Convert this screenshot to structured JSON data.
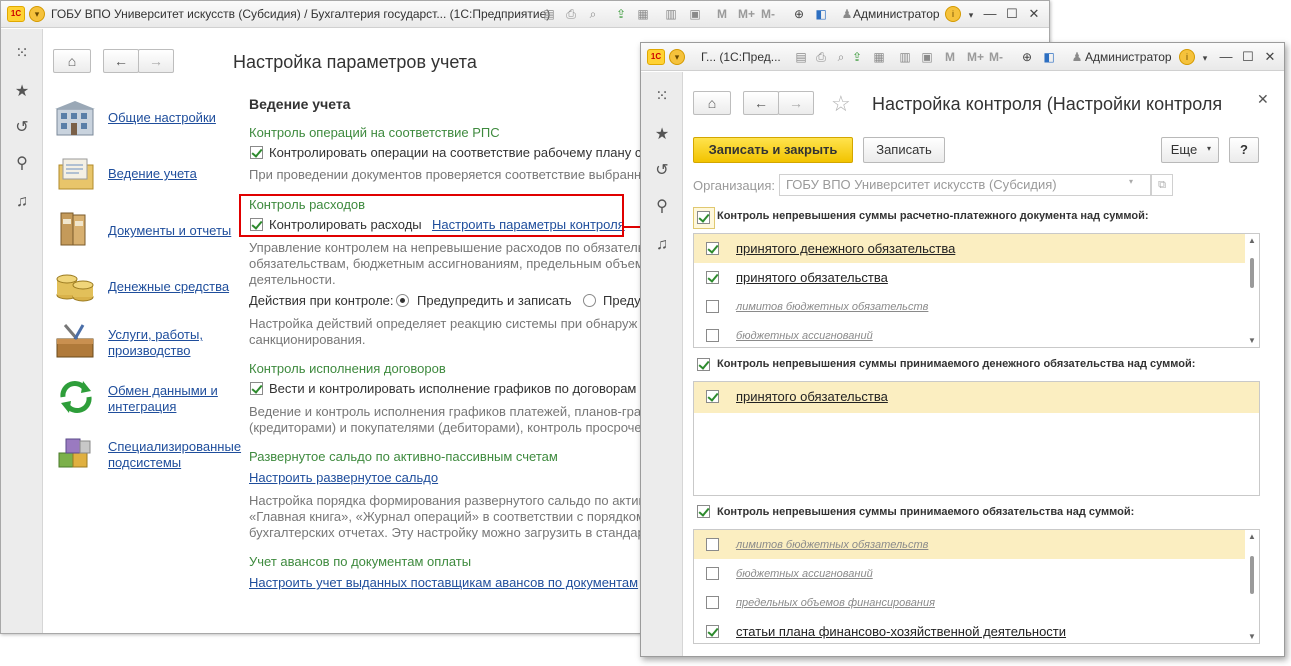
{
  "main": {
    "title": "ГОБУ ВПО Университет искусств (Субсидия) / Бухгалтерия государст... (1С:Предприятие)",
    "toolbar": {
      "m": "M",
      "mplus": "M+",
      "mminus": "M-"
    },
    "user": "Администратор",
    "page_title": "Настройка параметров учета",
    "nav": [
      {
        "label": "Общие настройки"
      },
      {
        "label": "Ведение учета"
      },
      {
        "label": "Документы и отчеты"
      },
      {
        "label": "Денежные средства"
      },
      {
        "label": "Услуги, работы,\nпроизводство"
      },
      {
        "label": "Обмен данными и\nинтеграция"
      },
      {
        "label": "Специализированные\nподсистемы"
      }
    ],
    "content": {
      "heading": "Ведение учета",
      "s1_head": "Контроль операций на соответствие РПС",
      "s1_chk": "Контролировать операции на соответствие рабочему плану сч",
      "s1_note": "При проведении документов проверяется соответствие выбранн",
      "s2_head": "Контроль расходов",
      "s2_chk": "Контролировать расходы",
      "s2_link": "Настроить параметры контроля",
      "s2_note1": "Управление контролем на непревышение расходов по обязатель",
      "s2_note2": "обязательствам, бюджетным ассигнованиям, предельным объемам",
      "s2_note3": "деятельности.",
      "s2_actions": "Действия при контроле:",
      "s2_radio1": "Предупредить и записать",
      "s2_radio2": "Преду",
      "s2_note4": "Настройка действий определяет реакцию системы при обнаруж",
      "s2_note5": "санкционирования.",
      "s3_head": "Контроль исполнения договоров",
      "s3_chk": "Вести и контролировать исполнение графиков по договорам с",
      "s3_note1": "Ведение и контроль исполнения графиков платежей, планов-граф",
      "s3_note2": "(кредиторами) и покупателями (дебиторами), контроль просроче",
      "s4_head": "Развернутое сальдо по активно-пассивным счетам",
      "s4_link": "Настроить развернутое сальдо",
      "s4_note1": "Настройка порядка формирования развернутого сальдо по актив",
      "s4_note2": "«Главная книга», «Журнал операций» в соответствии с порядком",
      "s4_note3": "бухгалтерских отчетах. Эту настройку можно загрузить в стандар",
      "s5_head": "Учет авансов по документам оплаты",
      "s5_link": "Настроить учет выданных поставщикам авансов по документам"
    }
  },
  "dialog": {
    "titlebar_text": "Г...  (1С:Пред...",
    "user": "Администратор",
    "title": "Настройка контроля (Настройки контроля",
    "btn_save_close": "Записать и закрыть",
    "btn_save": "Записать",
    "btn_more": "Еще",
    "btn_help": "?",
    "org_label": "Организация:",
    "org_value": "ГОБУ ВПО Университет искусств (Субсидия)",
    "group1": {
      "title": "Контроль непревышения суммы расчетно-платежного документа над суммой:",
      "checked": true,
      "items": [
        {
          "label": "принятого денежного обязательства",
          "checked": true
        },
        {
          "label": "принятого обязательства",
          "checked": true
        },
        {
          "label": "лимитов бюджетных обязательств",
          "checked": false
        },
        {
          "label": "бюджетных ассигнований",
          "checked": false
        }
      ]
    },
    "group2": {
      "title": "Контроль непревышения суммы принимаемого денежного обязательства над суммой:",
      "checked": true,
      "items": [
        {
          "label": "принятого обязательства",
          "checked": true
        }
      ]
    },
    "group3": {
      "title": "Контроль непревышения суммы принимаемого обязательства над суммой:",
      "checked": true,
      "items": [
        {
          "label": "лимитов бюджетных обязательств",
          "checked": false
        },
        {
          "label": "бюджетных ассигнований",
          "checked": false
        },
        {
          "label": "предельных объемов финансирования",
          "checked": false
        },
        {
          "label": "статьи плана финансово-хозяйственной деятельности",
          "checked": true
        }
      ]
    }
  },
  "colors": {
    "accent_red": "#e00000",
    "link": "#1f4e9c",
    "section_green": "#3e8a3e",
    "highlight_row": "#fbeec1",
    "primary_button": "#f2c300"
  }
}
